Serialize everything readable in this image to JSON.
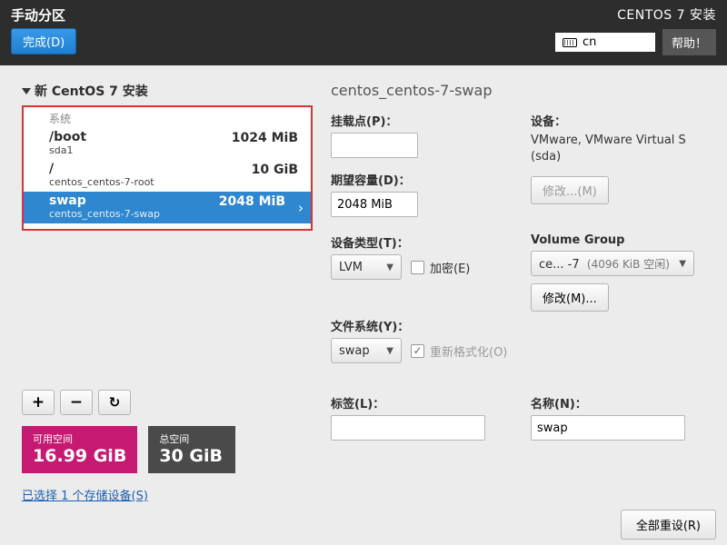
{
  "topbar": {
    "title": "手动分区",
    "done": "完成(D)",
    "installer": "CENTOS 7 安装",
    "lang": "cn",
    "help": "帮助！"
  },
  "left": {
    "header": "新 CentOS 7 安装",
    "group": "系统",
    "partitions": [
      {
        "name": "/boot",
        "sub": "sda1",
        "size": "1024 MiB"
      },
      {
        "name": "/",
        "sub": "centos_centos-7-root",
        "size": "10 GiB"
      },
      {
        "name": "swap",
        "sub": "centos_centos-7-swap",
        "size": "2048 MiB"
      }
    ],
    "add": "+",
    "remove": "−",
    "reload": "↻",
    "avail_label": "可用空间",
    "avail_val": "16.99 GiB",
    "total_label": "总空间",
    "total_val": "30 GiB",
    "storage_link": "已选择 1 个存储设备(S)"
  },
  "detail": {
    "title": "centos_centos-7-swap",
    "mount_label": "挂载点(P)：",
    "device_label": "设备：",
    "device_text": "VMware, VMware Virtual S (sda)",
    "modify_disabled": "修改...(M)",
    "capacity_label": "期望容量(D)：",
    "capacity_value": "2048 MiB",
    "devtype_label": "设备类型(T)：",
    "devtype_value": "LVM",
    "encrypt": "加密(E)",
    "vg_label": "Volume Group",
    "vg_value": "ce... -7",
    "vg_extra": "(4096 KiB 空闲)",
    "modify": "修改(M)...",
    "fs_label": "文件系统(Y)：",
    "fs_value": "swap",
    "reformat": "重新格式化(O)",
    "tag_label": "标签(L)：",
    "name_label": "名称(N)：",
    "name_value": "swap"
  },
  "bottom": {
    "reset": "全部重设(R)"
  }
}
